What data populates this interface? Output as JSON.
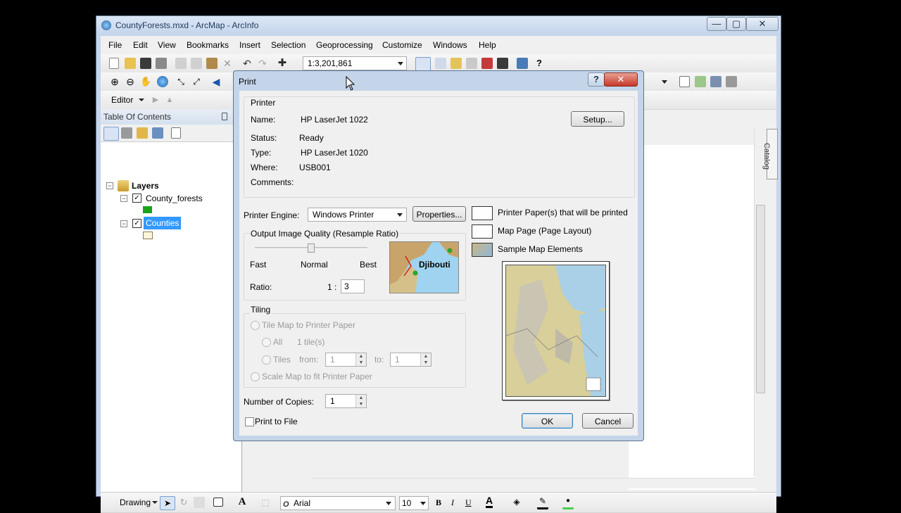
{
  "window": {
    "title": "CountyForests.mxd - ArcMap - ArcInfo",
    "controls": {
      "minimize": "—",
      "maximize": "▢",
      "close": "✕"
    }
  },
  "menu": [
    "File",
    "Edit",
    "View",
    "Bookmarks",
    "Insert",
    "Selection",
    "Geoprocessing",
    "Customize",
    "Windows",
    "Help"
  ],
  "toolbar": {
    "scale": "1:3,201,861",
    "editor_label": "Editor",
    "drawing_label": "Drawing",
    "font_name": "Arial",
    "font_size": "10",
    "bold": "B",
    "italic": "I",
    "underline": "U",
    "font_color_glyph": "A"
  },
  "toc": {
    "title": "Table Of Contents",
    "layers_label": "Layers",
    "items": [
      {
        "label": "County_forests",
        "swatch": "#1aa31a",
        "checked": true
      },
      {
        "label": "Counties",
        "swatch": "#fdf5dc",
        "checked": true,
        "selected": true
      }
    ]
  },
  "catalog_tab": "Catalog",
  "dialog": {
    "title": "Print",
    "help_glyph": "?",
    "close_glyph": "✕",
    "printer": {
      "group_label": "Printer",
      "name_label": "Name:",
      "name_value": "HP LaserJet 1022",
      "setup_button": "Setup...",
      "status_label": "Status:",
      "status_value": "Ready",
      "type_label": "Type:",
      "type_value": "HP LaserJet 1020",
      "where_label": "Where:",
      "where_value": "USB001",
      "comments_label": "Comments:"
    },
    "engine": {
      "label": "Printer Engine:",
      "value": "Windows Printer",
      "properties_button": "Properties..."
    },
    "quality": {
      "group_label": "Output Image Quality (Resample Ratio)",
      "fast": "Fast",
      "normal": "Normal",
      "best": "Best",
      "slider_fraction": 0.5,
      "ratio_label": "Ratio:",
      "ratio_prefix": "1 :",
      "ratio_value": "3",
      "preview_label": "Djibouti"
    },
    "tiling": {
      "group_label": "Tiling",
      "tile_option": "Tile Map to Printer Paper",
      "all_option": "All",
      "tile_count": "1 tile(s)",
      "tiles_option": "Tiles",
      "from_label": "from:",
      "from_value": "1",
      "to_label": "to:",
      "to_value": "1",
      "scale_option": "Scale Map to fit Printer Paper"
    },
    "copies": {
      "label": "Number of Copies:",
      "value": "1"
    },
    "print_to_file": "Print to File",
    "legend": [
      {
        "label": "Printer Paper(s) that will be printed"
      },
      {
        "label": "Map Page (Page Layout)"
      },
      {
        "label": "Sample Map Elements"
      }
    ],
    "ok_button": "OK",
    "cancel_button": "Cancel"
  },
  "colors": {
    "selection": "#3399ff",
    "title_text": "#1e395b"
  }
}
